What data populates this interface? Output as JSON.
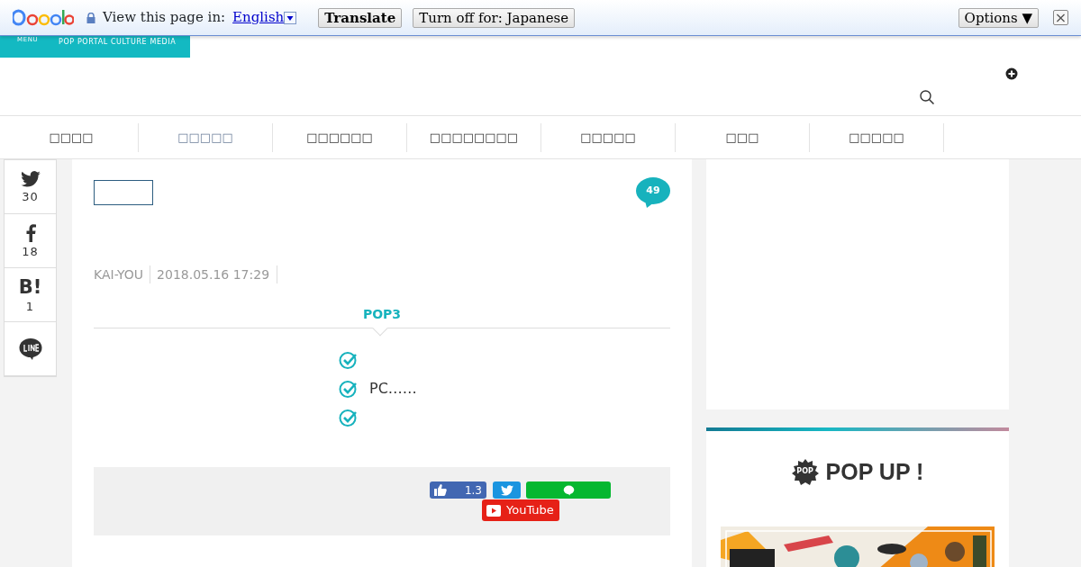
{
  "translate_bar": {
    "prompt": "View this page in:",
    "language": "English",
    "translate_button": "Translate",
    "turn_off_button": "Turn off for: Japanese",
    "options_button": "Options ▼",
    "close": "×"
  },
  "header": {
    "menu_label": "MENU",
    "tagline": "POP PORTAL CULTURE MEDIA"
  },
  "nav": [
    {
      "label": "□□□□",
      "selected": false
    },
    {
      "label": "□□□□□",
      "selected": true
    },
    {
      "label": "□□□□□□",
      "selected": false
    },
    {
      "label": "□□□□□□□□",
      "selected": false
    },
    {
      "label": "□□□□□",
      "selected": false
    },
    {
      "label": "□□□",
      "selected": false
    },
    {
      "label": "□□□□□",
      "selected": false
    }
  ],
  "share_sidebar": [
    {
      "kind": "twitter",
      "count": "30"
    },
    {
      "kind": "facebook",
      "count": "18"
    },
    {
      "kind": "hatena",
      "glyph": "B!",
      "count": "1"
    },
    {
      "kind": "line"
    }
  ],
  "article": {
    "comment_count": "49",
    "author": "KAI-YOU",
    "date": "2018.05.16 17:29",
    "summary_title": "POP3",
    "summary": [
      {
        "kind": "blank"
      },
      {
        "kind": "text",
        "text": "PC……"
      },
      {
        "kind": "blank"
      }
    ],
    "follow": {
      "like_count": "1.3",
      "youtube": "YouTube"
    }
  },
  "popup": {
    "title": "POP UP !",
    "badge": "POP"
  }
}
